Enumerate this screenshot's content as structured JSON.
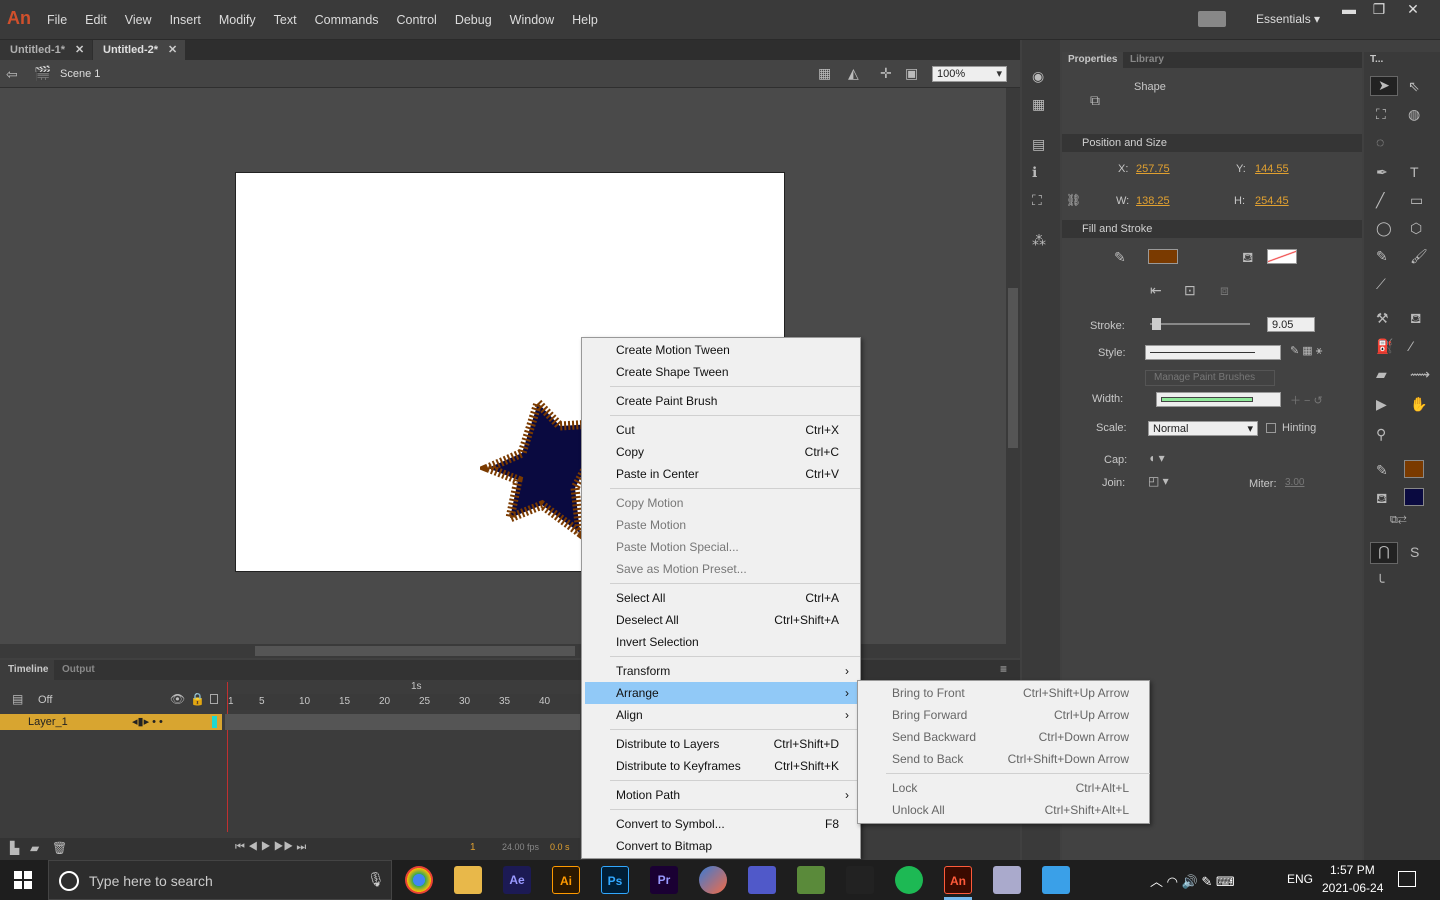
{
  "app": {
    "logo": "An"
  },
  "menu": [
    "File",
    "Edit",
    "View",
    "Insert",
    "Modify",
    "Text",
    "Commands",
    "Control",
    "Debug",
    "Window",
    "Help"
  ],
  "workspace": {
    "label": "Essentials",
    "chevron": "▾"
  },
  "tabs": [
    {
      "label": "Untitled-1*"
    },
    {
      "label": "Untitled-2*"
    }
  ],
  "scene": {
    "label": "Scene 1",
    "zoom": "100%"
  },
  "timeline": {
    "tabs": [
      "Timeline",
      "Output"
    ],
    "onion": "Off",
    "layer": "Layer_1",
    "ruler_1s": "1s",
    "frames": [
      "1",
      "5",
      "10",
      "15",
      "20",
      "25",
      "30",
      "35",
      "40"
    ],
    "current_frame": "1",
    "fps": "24.00 fps",
    "time": "0.0 s"
  },
  "properties": {
    "tabs": [
      "Properties",
      "Library"
    ],
    "object_type": "Shape",
    "position_section": "Position and Size",
    "x_label": "X:",
    "x": "257.75",
    "y_label": "Y:",
    "y": "144.55",
    "w_label": "W:",
    "w": "138.25",
    "h_label": "H:",
    "h": "254.45",
    "fill_section": "Fill and Stroke",
    "stroke_color": "#7a3a00",
    "stroke_label": "Stroke:",
    "stroke": "9.05",
    "style_label": "Style:",
    "manage_brushes": "Manage Paint Brushes",
    "width_label": "Width:",
    "scale_label": "Scale:",
    "scale": "Normal",
    "hinting": "Hinting",
    "cap_label": "Cap:",
    "join_label": "Join:",
    "miter_label": "Miter:",
    "miter": "3.00"
  },
  "tools_header": "T...",
  "context_menu": [
    {
      "label": "Create Motion Tween"
    },
    {
      "label": "Create Shape Tween"
    },
    {
      "label": "Create Paint Brush"
    },
    {
      "label": "Cut",
      "shortcut": "Ctrl+X"
    },
    {
      "label": "Copy",
      "shortcut": "Ctrl+C"
    },
    {
      "label": "Paste in Center",
      "shortcut": "Ctrl+V"
    },
    {
      "label": "Copy Motion"
    },
    {
      "label": "Paste Motion"
    },
    {
      "label": "Paste Motion Special..."
    },
    {
      "label": "Save as Motion Preset..."
    },
    {
      "label": "Select All",
      "shortcut": "Ctrl+A"
    },
    {
      "label": "Deselect All",
      "shortcut": "Ctrl+Shift+A"
    },
    {
      "label": "Invert Selection"
    },
    {
      "label": "Transform",
      "arrow": "›"
    },
    {
      "label": "Arrange",
      "arrow": "›"
    },
    {
      "label": "Align",
      "arrow": "›"
    },
    {
      "label": "Distribute to Layers",
      "shortcut": "Ctrl+Shift+D"
    },
    {
      "label": "Distribute to Keyframes",
      "shortcut": "Ctrl+Shift+K"
    },
    {
      "label": "Motion Path",
      "arrow": "›"
    },
    {
      "label": "Convert to Symbol...",
      "shortcut": "F8"
    },
    {
      "label": "Convert to Bitmap"
    }
  ],
  "arrange_submenu": [
    {
      "label": "Bring to Front",
      "shortcut": "Ctrl+Shift+Up Arrow"
    },
    {
      "label": "Bring Forward",
      "shortcut": "Ctrl+Up Arrow"
    },
    {
      "label": "Send Backward",
      "shortcut": "Ctrl+Down Arrow"
    },
    {
      "label": "Send to Back",
      "shortcut": "Ctrl+Shift+Down Arrow"
    },
    {
      "label": "Lock",
      "shortcut": "Ctrl+Alt+L"
    },
    {
      "label": "Unlock All",
      "shortcut": "Ctrl+Shift+Alt+L"
    }
  ],
  "taskbar": {
    "search_placeholder": "Type here to search",
    "lang": "ENG",
    "time": "1:57 PM",
    "date": "2021-06-24",
    "apps": [
      "Ae",
      "Ai",
      "Ps",
      "Pr",
      "An"
    ]
  },
  "colors": {
    "fill": "#0a0a40",
    "stroke": "#7a3a00",
    "highlight": "#91c9f7"
  }
}
